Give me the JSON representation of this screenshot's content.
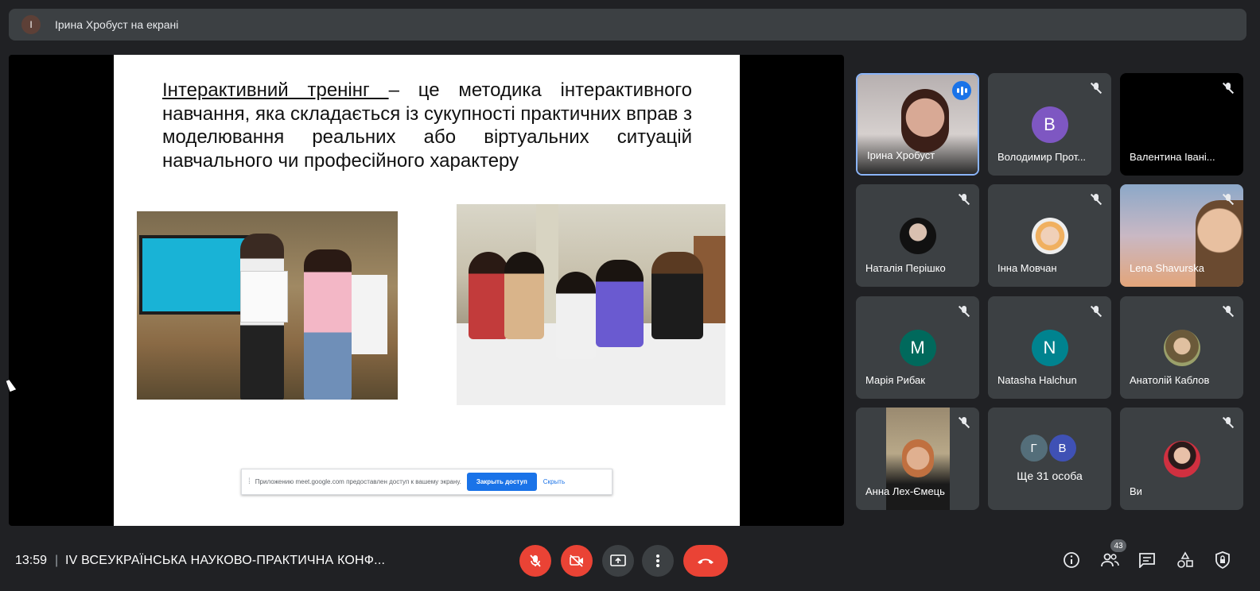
{
  "top_bar": {
    "presenter_initial": "I",
    "title": "Ірина Хробуст на екрані"
  },
  "slide": {
    "term": "Інтерактивний тренінг ",
    "definition": "– це методика інтерактивного навчання, яка складається із сукупності практичних вправ з моделювання реальних або віртуальних ситуацій навчального чи професійного характеру"
  },
  "share_bar": {
    "message": "Приложению meet.google.com предоставлен доступ к вашему экрану.",
    "stop_label": "Закрыть доступ",
    "hide_label": "Скрыть"
  },
  "participants": [
    {
      "name": "Ірина Хробуст",
      "type": "video",
      "speaking": true
    },
    {
      "name": "Володимир Прот...",
      "type": "initial",
      "initial": "В",
      "color": "#7e57c2",
      "muted": true
    },
    {
      "name": "Валентина Івані...",
      "type": "dark",
      "muted": true
    },
    {
      "name": "Наталія Перішко",
      "type": "photo",
      "muted": true
    },
    {
      "name": "Інна Мовчан",
      "type": "photo",
      "muted": true
    },
    {
      "name": "Lena Shavurska",
      "type": "video",
      "muted": true
    },
    {
      "name": "Марія Рибак",
      "type": "initial",
      "initial": "M",
      "color": "#00695c",
      "muted": true
    },
    {
      "name": "Natasha Halchun",
      "type": "initial",
      "initial": "N",
      "color": "#00838f",
      "muted": true
    },
    {
      "name": "Анатолій Каблов",
      "type": "photo",
      "muted": true
    },
    {
      "name": "Анна Лех-Ємець",
      "type": "video",
      "muted": true
    },
    {
      "name": "Ще 31 особа",
      "type": "more",
      "initials": [
        "Г",
        "В"
      ]
    },
    {
      "name": "Ви",
      "type": "photo",
      "muted": true
    }
  ],
  "bottom_bar": {
    "time": "13:59",
    "separator": "|",
    "meeting_title": "IV ВСЕУКРАЇНСЬКА НАУКОВО-ПРАКТИЧНА КОНФ...",
    "people_count": "43"
  },
  "colors": {
    "background": "#202124",
    "surface": "#3c4043",
    "danger": "#ea4335",
    "accent": "#1a73e8"
  },
  "icons": [
    "mic-off-icon",
    "camera-off-icon",
    "present-screen-icon",
    "more-options-icon",
    "end-call-icon",
    "info-icon",
    "people-icon",
    "chat-icon",
    "activities-icon",
    "host-controls-icon"
  ]
}
